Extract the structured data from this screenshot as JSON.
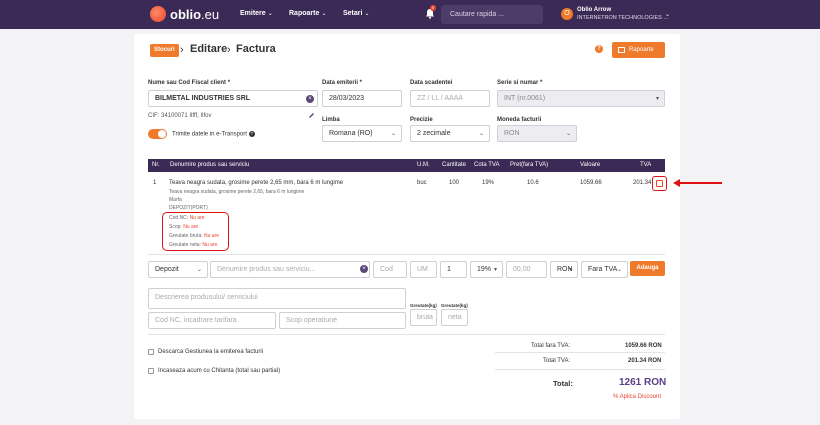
{
  "nav": {
    "logo_brand": "oblio",
    "logo_tld": ".eu",
    "menu": [
      "Emitere",
      "Rapoarte",
      "Setari"
    ],
    "notif_count": "0",
    "search_placeholder": "Cautare rapida ...",
    "user_initial": "O",
    "user_name": "Oblio Arrow",
    "user_company": "INTERNETRON TECHNOLOGIES ..."
  },
  "header": {
    "badge": "Stocuri",
    "crumb1": "Editare",
    "crumb2": "Factura",
    "help": "?",
    "reports_btn": "Rapoarte"
  },
  "form": {
    "client_label": "Nume sau Cod Fiscal client *",
    "client_value": "BILMETAL INDUSTRIES SRL",
    "client_info": "CIF: 34100071    Ilfff, Ilfov",
    "issue_label": "Data emiterii *",
    "issue_value": "28/03/2023",
    "due_label": "Data scadentei",
    "due_placeholder": "ZZ / LL / AAAA",
    "series_label": "Serie si numar *",
    "series_value": "INT (nr.0061)",
    "lang_label": "Limba",
    "lang_value": "Romana (RO)",
    "precision_label": "Precizie",
    "precision_value": "2 zecimale",
    "currency_label": "Moneda facturii",
    "currency_value": "RON",
    "etransport_label": "Trimite datele in e-Transport"
  },
  "table": {
    "headers": [
      "Nr.",
      "Denumire produs sau serviciu",
      "U.M.",
      "Cantitate",
      "Cota TVA",
      "Pret(fara TVA)",
      "Valoare",
      "TVA"
    ],
    "row": {
      "nr": "1",
      "name": "Teava neagra sudata, grosime perete 2,65 mm, bara 6 m lungime",
      "desc": "Teava neagra sudata, grosime perete 2,65, bara 6 m lungime",
      "type": "Marfa",
      "warehouse": "DEPOZIT(PORT)",
      "um": "buc",
      "qty": "100",
      "vat_rate": "19%",
      "price": "10.6",
      "value": "1059.66",
      "vat": "201.34",
      "extras": [
        {
          "label": "Cod NC:",
          "value": "Nu are"
        },
        {
          "label": "Scop:",
          "value": "Nu are"
        },
        {
          "label": "Greutate bruta:",
          "value": "Nu are"
        },
        {
          "label": "Greutate neta:",
          "value": "Nu are"
        }
      ]
    }
  },
  "entry": {
    "warehouse": "Depozit",
    "product_placeholder": "Denumire produs sau serviciu...",
    "code_placeholder": "Cod",
    "um_placeholder": "UM",
    "qty": "1",
    "vat": "19%",
    "price_placeholder": "00,00",
    "currency": "RON",
    "vat_mode": "Fara TVA",
    "add_btn": "Adauga",
    "desc_placeholder": "Descrierea produsului/ serviciului",
    "nc_placeholder": "Cod NC, incadrare tarifara",
    "purpose_placeholder": "Scop operatiune",
    "gross_label": "Greutate(kg)",
    "gross_placeholder": "bruta",
    "net_label": "Greutate(kg)",
    "net_placeholder": "neta"
  },
  "options": {
    "stock_discharge": "Descarca Gestiunea la emiterea facturii",
    "receipt": "Incaseaza acum cu Chitanta (total sau partial)"
  },
  "totals": {
    "no_vat_label": "Total fara TVA:",
    "no_vat_value": "1059.66 RON",
    "vat_label": "Total TVA:",
    "vat_value": "201.34 RON",
    "total_label": "Total:",
    "total_value": "1261 RON",
    "discount": "% Aplica Discount"
  }
}
